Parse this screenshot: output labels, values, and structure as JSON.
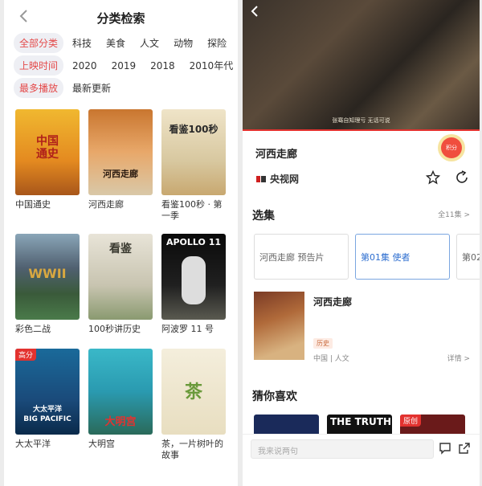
{
  "left": {
    "title": "分类检索",
    "categories": [
      "全部分类",
      "科技",
      "美食",
      "人文",
      "动物",
      "探险"
    ],
    "years": [
      "上映时间",
      "2020",
      "2019",
      "2018",
      "2010年代"
    ],
    "sort": [
      "最多播放",
      "最新更新"
    ],
    "covers": [
      {
        "title": "中国通史",
        "art": "中国\n通史",
        "badge": ""
      },
      {
        "title": "河西走廊",
        "art": "河西走廊",
        "badge": ""
      },
      {
        "title": "看鉴100秒 · 第一季",
        "art": "看鉴100秒",
        "badge": ""
      },
      {
        "title": "彩色二战",
        "art": "WWII",
        "badge": ""
      },
      {
        "title": "100秒讲历史",
        "art": "看鉴",
        "badge": ""
      },
      {
        "title": "阿波罗 11 号",
        "art": "APOLLO 11",
        "badge": ""
      },
      {
        "title": "大太平洋",
        "art": "大太平洋\nBIG PACIFIC",
        "badge": "高分"
      },
      {
        "title": "大明宫",
        "art": "大明宫",
        "badge": ""
      },
      {
        "title": "茶，一片树叶的故事",
        "art": "茶",
        "badge": ""
      }
    ]
  },
  "right": {
    "video_subtitle": "张骞自知理亏 无话可说",
    "show_title": "河西走廊",
    "points_label": "积分",
    "channel_name": "央视网",
    "episodes_heading": "选集",
    "all_episodes": "全11集 >",
    "episodes": [
      "河西走廊 预告片",
      "第01集 使者",
      "第02"
    ],
    "info_title": "河西走廊",
    "info_tag": "历史",
    "info_meta": "中国 | 人文",
    "detail_link": "详情 >",
    "recommend_heading": "猜你喜欢",
    "recommend": [
      {
        "text": "",
        "badge": ""
      },
      {
        "text": "THE TRUTH",
        "badge": ""
      },
      {
        "text": "",
        "badge": "原创"
      }
    ],
    "comment_placeholder": "我来说两句"
  },
  "colors": {
    "accent": "#e44a4a",
    "selected_episode": "#2f6fd0"
  }
}
